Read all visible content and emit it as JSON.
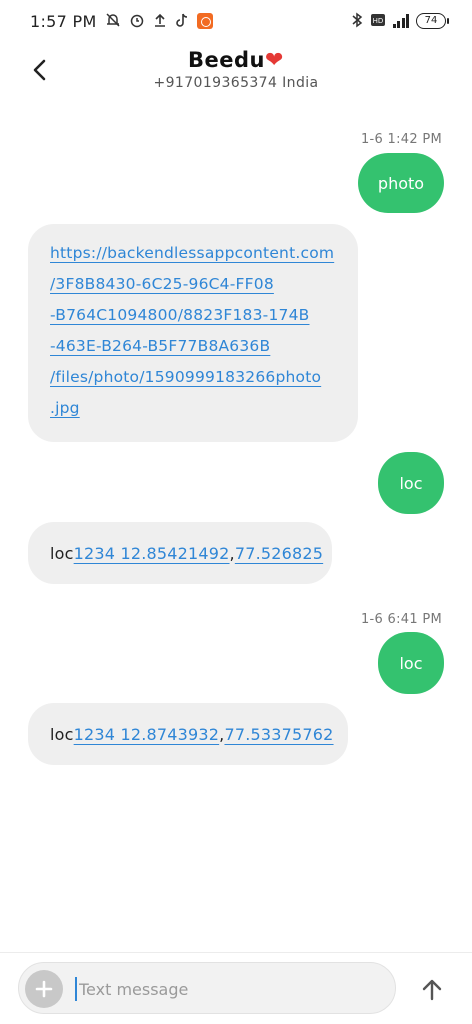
{
  "status_bar": {
    "time": "1:57 PM",
    "battery": "74",
    "icons": [
      "notification-off-icon",
      "alarm-icon",
      "upload-icon",
      "tiktok-icon",
      "app-notification-icon",
      "bluetooth-icon",
      "volte-icon",
      "signal-icon",
      "battery-icon"
    ]
  },
  "header": {
    "contact_name": "Beedu",
    "contact_emoji": "❤",
    "contact_number": "+917019365374 India",
    "back_icon": "back-arrow-icon"
  },
  "messages": [
    {
      "direction": "outgoing",
      "timestamp": "1-6 1:42 PM",
      "text": "photo"
    },
    {
      "direction": "incoming",
      "lines": [
        "https://backendlessappcontent.com",
        "/3F8B8430-6C25-96C4-FF08",
        "-B764C1094800/8823F183-174B",
        "-463E-B264-B5F77B8A636B",
        "/files/photo/1590999183266photo",
        ".jpg"
      ]
    },
    {
      "direction": "outgoing",
      "text": "loc"
    },
    {
      "direction": "incoming",
      "prefix": "loc",
      "link1": "1234 12.85421492",
      "sep": ",",
      "link2": "77.526825"
    },
    {
      "direction": "outgoing",
      "timestamp": "1-6 6:41 PM",
      "text": "loc"
    },
    {
      "direction": "incoming",
      "prefix": "loc",
      "link1": "1234 12.8743932",
      "sep": ",",
      "link2": "77.53375762"
    }
  ],
  "composer": {
    "placeholder": "Text message",
    "add_icon": "plus-icon",
    "send_icon": "send-arrow-icon"
  },
  "colors": {
    "outgoing_bubble": "#34c26f",
    "incoming_bubble": "#efefef",
    "link": "#2f86d6",
    "heart": "#e53935"
  }
}
